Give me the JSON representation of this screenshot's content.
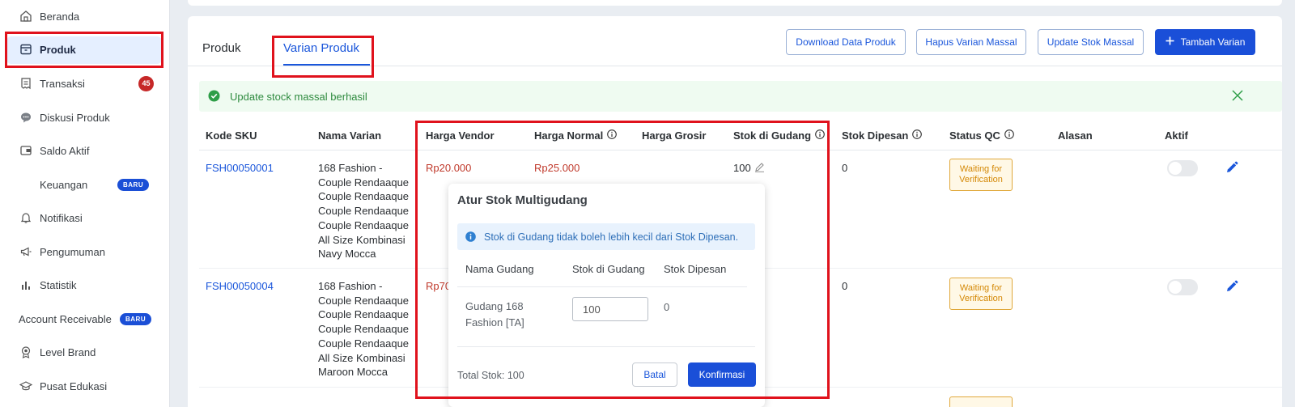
{
  "sidebar": {
    "items": [
      {
        "label": "Beranda",
        "icon": "home-icon"
      },
      {
        "label": "Produk",
        "icon": "box-icon"
      },
      {
        "label": "Transaksi",
        "icon": "receipt-icon",
        "badge": "45"
      },
      {
        "label": "Diskusi Produk",
        "icon": "chat-icon"
      },
      {
        "label": "Saldo Aktif",
        "icon": "wallet-icon"
      },
      {
        "label": "Keuangan",
        "badge": "BARU"
      },
      {
        "label": "Notifikasi",
        "icon": "bell-icon"
      },
      {
        "label": "Pengumuman",
        "icon": "megaphone-icon"
      },
      {
        "label": "Statistik",
        "icon": "bar-chart-icon"
      },
      {
        "label": "Account Receivable",
        "badge": "BARU"
      },
      {
        "label": "Level Brand",
        "icon": "medal-icon"
      },
      {
        "label": "Pusat Edukasi",
        "icon": "graduation-cap-icon"
      }
    ]
  },
  "tabs": [
    {
      "label": "Produk"
    },
    {
      "label": "Varian Produk"
    }
  ],
  "actions": {
    "download": "Download Data Produk",
    "hapus": "Hapus Varian Massal",
    "update": "Update Stok Massal",
    "tambah": "Tambah Varian"
  },
  "alert": {
    "text": "Update stock massal berhasil"
  },
  "table": {
    "headers": [
      "Kode SKU",
      "Nama Varian",
      "Harga Vendor",
      "Harga Normal",
      "Harga Grosir",
      "Stok di Gudang",
      "Stok Dipesan",
      "Status QC",
      "Alasan",
      "Aktif"
    ],
    "rows": [
      {
        "sku": "FSH00050001",
        "name": [
          "168 Fashion -",
          "Couple Rendaaque",
          "Couple Rendaaque",
          "Couple Rendaaque",
          "Couple Rendaaque",
          "All Size Kombinasi",
          "Navy Mocca"
        ],
        "vendor": "Rp20.000",
        "normal": "Rp25.000",
        "stock": "100",
        "ordered": "0",
        "qc": "Waiting for Verification"
      },
      {
        "sku": "FSH00050004",
        "name": [
          "168 Fashion -",
          "Couple Rendaaque",
          "Couple Rendaaque",
          "Couple Rendaaque",
          "Couple Rendaaque",
          "All Size Kombinasi",
          "Maroon Mocca"
        ],
        "vendor": "Rp70",
        "ordered": "0",
        "qc": "Waiting for Verification"
      }
    ]
  },
  "popover": {
    "title": "Atur Stok Multigudang",
    "info": "Stok di Gudang tidak boleh lebih kecil dari Stok Dipesan.",
    "headers": [
      "Nama Gudang",
      "Stok di Gudang",
      "Stok Dipesan"
    ],
    "warehouse": [
      "Gudang 168",
      "Fashion [TA]"
    ],
    "stock_value": "100",
    "ordered": "0",
    "total": "Total Stok: 100",
    "cancel": "Batal",
    "confirm": "Konfirmasi"
  },
  "colors": {
    "accent": "#1a56db",
    "primary_button": "#1a4fd8",
    "highlight": "#e0121c",
    "success": "#2e8b3f",
    "price": "#c0392b",
    "warning": "#d48806"
  }
}
